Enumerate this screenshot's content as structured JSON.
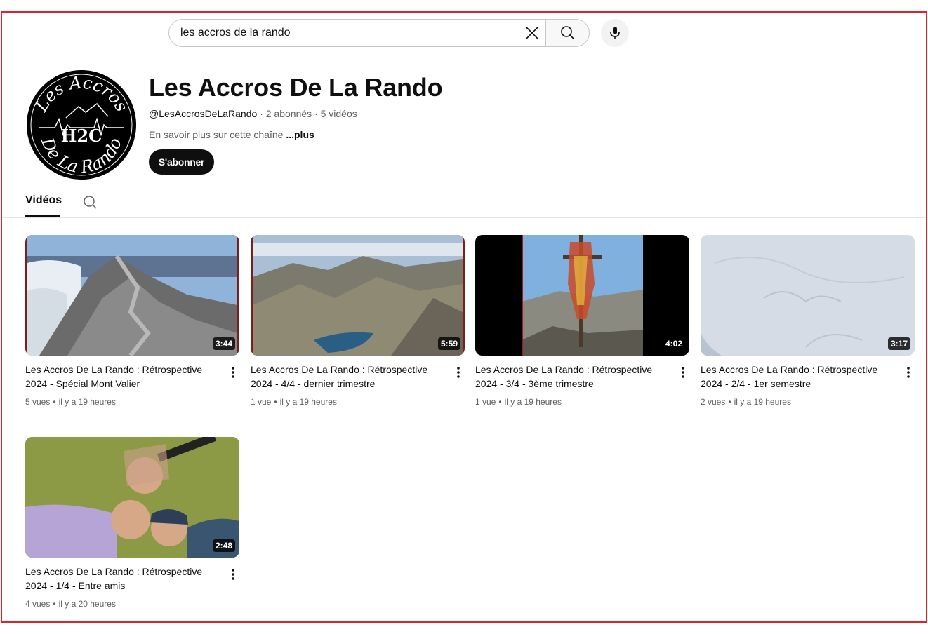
{
  "search": {
    "query": "les accros de la rando"
  },
  "channel": {
    "avatar_text_top": "Les Accros",
    "avatar_text_mid": "H2C",
    "avatar_text_bottom": "De La Rando",
    "name": "Les Accros De La Rando",
    "handle": "@LesAccrosDeLaRando",
    "subscribers": "2 abonnés",
    "video_count": "5 vidéos",
    "separator": "·",
    "about": "En savoir plus sur cette chaîne ",
    "about_more": "...plus",
    "subscribe_label": "S'abonner"
  },
  "tabs": {
    "videos_label": "Vidéos"
  },
  "videos": [
    {
      "title": "Les Accros De La Rando : Rétrospective 2024 - Spécial Mont Valier",
      "duration": "3:44",
      "views": "5 vues",
      "age": "il y a 19 heures"
    },
    {
      "title": "Les Accros De La Rando : Rétrospective 2024 - 4/4 - dernier trimestre",
      "duration": "5:59",
      "views": "1 vue",
      "age": "il y a 19 heures"
    },
    {
      "title": "Les Accros De La Rando : Rétrospective 2024 - 3/4 - 3ème trimestre",
      "duration": "4:02",
      "views": "1 vue",
      "age": "il y a 19 heures"
    },
    {
      "title": "Les Accros De La Rando : Rétrospective 2024 - 2/4 - 1er semestre",
      "duration": "3:17",
      "views": "2 vues",
      "age": "il y a 19 heures"
    },
    {
      "title": "Les Accros De La Rando : Rétrospective 2024 - 1/4 - Entre amis",
      "duration": "2:48",
      "views": "4 vues",
      "age": "il y a 20 heures"
    }
  ],
  "stats_separator": "•",
  "colors": {
    "frame": "#e0232a",
    "text": "#0f0f0f",
    "secondary": "#606060"
  }
}
